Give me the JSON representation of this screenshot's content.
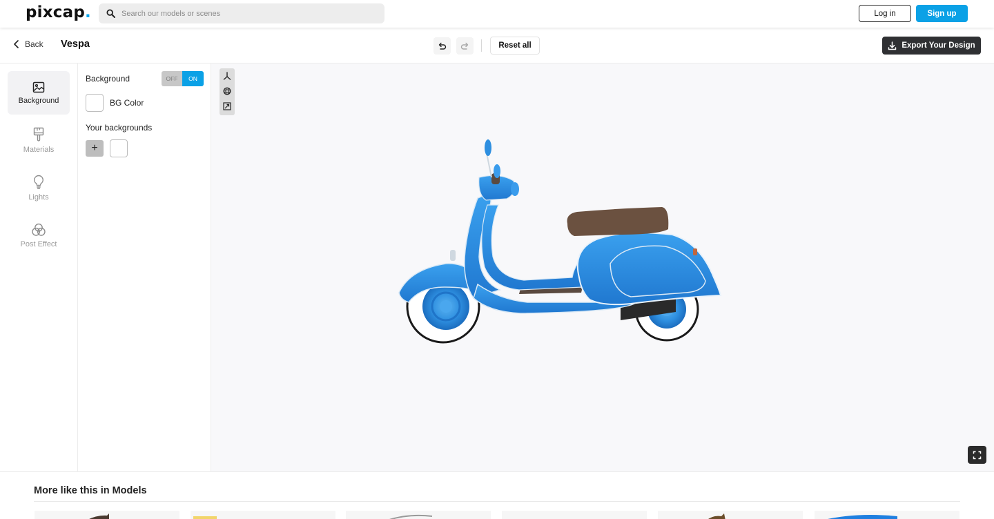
{
  "brand": {
    "logo_text": "pixcap",
    "logo_dot": ".",
    "accent": "#0ba1e6"
  },
  "search": {
    "placeholder": "Search our models or scenes"
  },
  "auth": {
    "login_label": "Log in",
    "signup_label": "Sign up"
  },
  "subheader": {
    "back_label": "Back",
    "title": "Vespa",
    "reset_label": "Reset all",
    "export_label": "Export Your Design"
  },
  "rail": {
    "items": [
      {
        "label": "Background",
        "icon": "image-icon",
        "active": true
      },
      {
        "label": "Materials",
        "icon": "paint-brush-icon",
        "active": false
      },
      {
        "label": "Lights",
        "icon": "lightbulb-icon",
        "active": false
      },
      {
        "label": "Post Effect",
        "icon": "color-circles-icon",
        "active": false
      }
    ]
  },
  "panel": {
    "background_label": "Background",
    "toggle_off": "OFF",
    "toggle_on": "ON",
    "toggle_state": "ON",
    "bg_color_label": "BG Color",
    "your_backgrounds_label": "Your backgrounds",
    "add_label": "+"
  },
  "viewport": {
    "tools": [
      "axis-gizmo-icon",
      "orbit-icon",
      "resize-frame-icon"
    ],
    "model_colors": {
      "body": "#2e8fe0",
      "seat": "#6b5140",
      "tire": "#ffffff"
    }
  },
  "more": {
    "title": "More like this in Models"
  }
}
